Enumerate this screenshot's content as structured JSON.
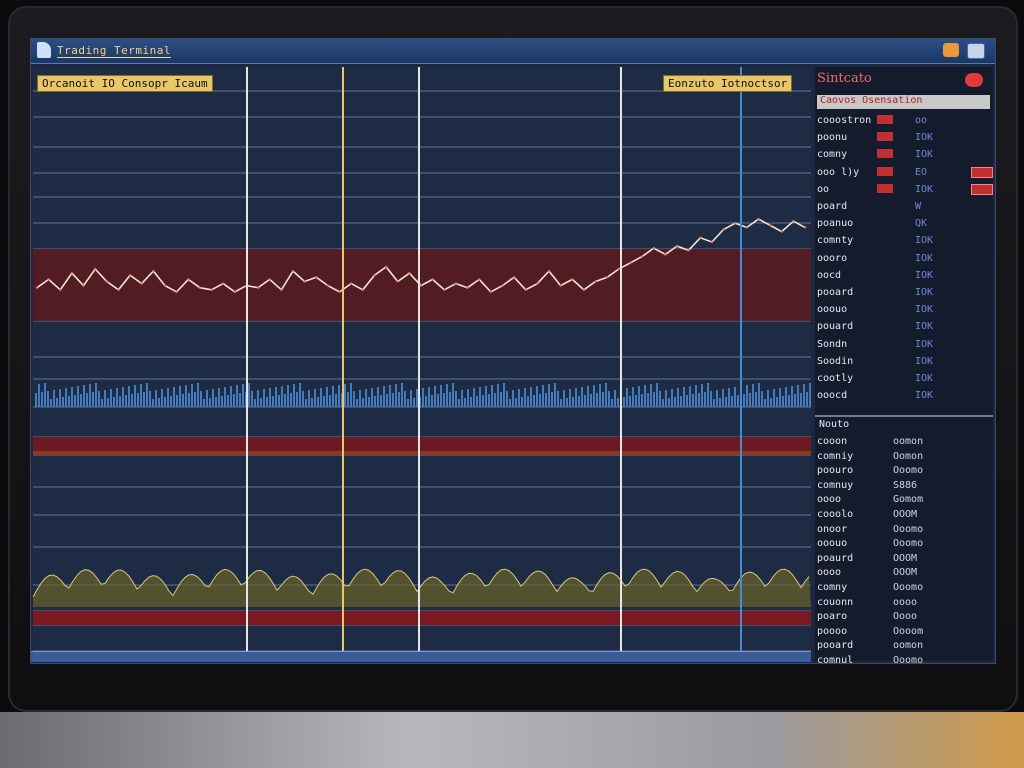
{
  "app": {
    "title": "Trading Terminal"
  },
  "chart": {
    "label_left": "Orcanoit IO Consopr Icaum",
    "label_right": "Eonzuto Iotnoctsor"
  },
  "side": {
    "title": "Sintcato",
    "header_label": "Caovos",
    "header_accent": "Osensation",
    "watchlist": [
      {
        "sym": "cooostron",
        "val": "oo"
      },
      {
        "sym": "poonu",
        "val": "IOK"
      },
      {
        "sym": "comny",
        "val": "IOK"
      },
      {
        "sym": "ooo l)y",
        "val": "EO"
      },
      {
        "sym": "oo",
        "val": "IOK"
      },
      {
        "sym": "poard",
        "val": "W"
      },
      {
        "sym": "poanuo",
        "val": "QK"
      },
      {
        "sym": "comnty",
        "val": "IOK"
      },
      {
        "sym": "oooro",
        "val": "IOK"
      },
      {
        "sym": "oocd",
        "val": "IOK"
      },
      {
        "sym": "pooard",
        "val": "IOK"
      },
      {
        "sym": "ooouo",
        "val": "IOK"
      },
      {
        "sym": "pouard",
        "val": "IOK"
      },
      {
        "sym": "Sondn",
        "val": "IOK"
      },
      {
        "sym": "Soodin",
        "val": "IOK"
      },
      {
        "sym": "cootly",
        "val": "IOK"
      },
      {
        "sym": "ooocd",
        "val": "IOK"
      }
    ],
    "orders_title": "Nouto",
    "orders": [
      {
        "sym": "cooon",
        "num": "oomon"
      },
      {
        "sym": "comniy",
        "num": "Oomon"
      },
      {
        "sym": "poouro",
        "num": "Ooomo"
      },
      {
        "sym": "comnuy",
        "num": "S886"
      },
      {
        "sym": "oooo",
        "num": "Gomom"
      },
      {
        "sym": "cooolo",
        "num": "OOOM"
      },
      {
        "sym": "onoor",
        "num": "Ooomo"
      },
      {
        "sym": "ooouo",
        "num": "Ooomo"
      },
      {
        "sym": "poaurd",
        "num": "OOOM"
      },
      {
        "sym": "oooo",
        "num": "OOOM"
      },
      {
        "sym": "comny",
        "num": "Ooomo"
      },
      {
        "sym": "couonn",
        "num": "oooo"
      },
      {
        "sym": "poaro",
        "num": "Oooo"
      },
      {
        "sym": "poooo",
        "num": "Oooom"
      },
      {
        "sym": "pooard",
        "num": "oomon"
      },
      {
        "sym": "comnul",
        "num": "Ooomo"
      }
    ]
  },
  "colors": {
    "accent": "#e8c66a",
    "alert": "#c03030",
    "line": "#f2e6c8",
    "volume": "#4a8ad0",
    "oscillator": "#d8c878"
  },
  "chart_data": {
    "type": "line",
    "series": [
      {
        "values": [
          0.32,
          0.4,
          0.3,
          0.46,
          0.34,
          0.5,
          0.38,
          0.3,
          0.44,
          0.36,
          0.48,
          0.34,
          0.28,
          0.4,
          0.32,
          0.3,
          0.36,
          0.28,
          0.34,
          0.32,
          0.4,
          0.3,
          0.48,
          0.38,
          0.42,
          0.34,
          0.28,
          0.36,
          0.3,
          0.44,
          0.52,
          0.38,
          0.46,
          0.34,
          0.4,
          0.3,
          0.36,
          0.32,
          0.4,
          0.28,
          0.34,
          0.42,
          0.3,
          0.36,
          0.48,
          0.34,
          0.4,
          0.3,
          0.38,
          0.42,
          0.5,
          0.56,
          0.62,
          0.7,
          0.64,
          0.72,
          0.68,
          0.8,
          0.76,
          0.88,
          0.94,
          0.9,
          0.98,
          0.92,
          0.86,
          0.96,
          0.9
        ]
      }
    ]
  }
}
